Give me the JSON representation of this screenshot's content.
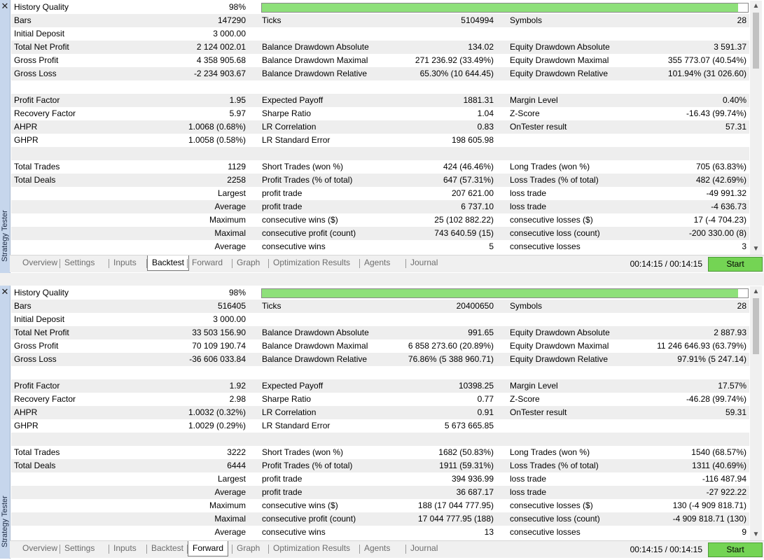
{
  "colors": {
    "progress_fill": "#8ee07a",
    "start_button": "#74d454",
    "sidebar": "#c6d6ec",
    "row_alt": "#eeeeee"
  },
  "panels": [
    {
      "side_label": "Strategy Tester",
      "history_quality_label": "History Quality",
      "history_quality_value": "98%",
      "history_quality_fraction": 0.98,
      "rows": [
        [
          "Bars",
          "147290",
          "Ticks",
          "5104994",
          "Symbols",
          "28"
        ],
        [
          "Initial Deposit",
          "3 000.00",
          "",
          "",
          "",
          ""
        ],
        [
          "Total Net Profit",
          "2 124 002.01",
          "Balance Drawdown Absolute",
          "134.02",
          "Equity Drawdown Absolute",
          "3 591.37"
        ],
        [
          "Gross Profit",
          "4 358 905.68",
          "Balance Drawdown Maximal",
          "271 236.92 (33.49%)",
          "Equity Drawdown Maximal",
          "355 773.07 (40.54%)"
        ],
        [
          "Gross Loss",
          "-2 234 903.67",
          "Balance Drawdown Relative",
          "65.30% (10 644.45)",
          "Equity Drawdown Relative",
          "101.94% (31 026.60)"
        ],
        [
          "",
          "",
          "",
          "",
          "",
          ""
        ],
        [
          "Profit Factor",
          "1.95",
          "Expected Payoff",
          "1881.31",
          "Margin Level",
          "0.40%"
        ],
        [
          "Recovery Factor",
          "5.97",
          "Sharpe Ratio",
          "1.04",
          "Z-Score",
          "-16.43 (99.74%)"
        ],
        [
          "AHPR",
          "1.0068 (0.68%)",
          "LR Correlation",
          "0.83",
          "OnTester result",
          "57.31"
        ],
        [
          "GHPR",
          "1.0058 (0.58%)",
          "LR Standard Error",
          "198 605.98",
          "",
          ""
        ],
        [
          "",
          "",
          "",
          "",
          "",
          ""
        ],
        [
          "Total Trades",
          "1129",
          "Short Trades (won %)",
          "424 (46.46%)",
          "Long Trades (won %)",
          "705 (63.83%)"
        ],
        [
          "Total Deals",
          "2258",
          "Profit Trades (% of total)",
          "647 (57.31%)",
          "Loss Trades (% of total)",
          "482 (42.69%)"
        ],
        [
          "",
          "Largest",
          "profit trade",
          "207 621.00",
          "loss trade",
          "-49 991.32"
        ],
        [
          "",
          "Average",
          "profit trade",
          "6 737.10",
          "loss trade",
          "-4 636.73"
        ],
        [
          "",
          "Maximum",
          "consecutive wins ($)",
          "25 (102 882.22)",
          "consecutive losses ($)",
          "17 (-4 704.23)"
        ],
        [
          "",
          "Maximal",
          "consecutive profit (count)",
          "743 640.59 (15)",
          "consecutive loss (count)",
          "-200 330.00 (8)"
        ],
        [
          "",
          "Average",
          "consecutive wins",
          "5",
          "consecutive losses",
          "3"
        ]
      ],
      "tabs": [
        "Overview",
        "Settings",
        "Inputs",
        "Backtest",
        "Forward",
        "Graph",
        "Optimization Results",
        "Agents",
        "Journal"
      ],
      "active_tab": "Backtest",
      "timer": "00:14:15 / 00:14:15",
      "start_label": "Start"
    },
    {
      "side_label": "Strategy Tester",
      "history_quality_label": "History Quality",
      "history_quality_value": "98%",
      "history_quality_fraction": 0.98,
      "rows": [
        [
          "Bars",
          "516405",
          "Ticks",
          "20400650",
          "Symbols",
          "28"
        ],
        [
          "Initial Deposit",
          "3 000.00",
          "",
          "",
          "",
          ""
        ],
        [
          "Total Net Profit",
          "33 503 156.90",
          "Balance Drawdown Absolute",
          "991.65",
          "Equity Drawdown Absolute",
          "2 887.93"
        ],
        [
          "Gross Profit",
          "70 109 190.74",
          "Balance Drawdown Maximal",
          "6 858 273.60 (20.89%)",
          "Equity Drawdown Maximal",
          "11 246 646.93 (63.79%)"
        ],
        [
          "Gross Loss",
          "-36 606 033.84",
          "Balance Drawdown Relative",
          "76.86% (5 388 960.71)",
          "Equity Drawdown Relative",
          "97.91% (5 247.14)"
        ],
        [
          "",
          "",
          "",
          "",
          "",
          ""
        ],
        [
          "Profit Factor",
          "1.92",
          "Expected Payoff",
          "10398.25",
          "Margin Level",
          "17.57%"
        ],
        [
          "Recovery Factor",
          "2.98",
          "Sharpe Ratio",
          "0.77",
          "Z-Score",
          "-46.28 (99.74%)"
        ],
        [
          "AHPR",
          "1.0032 (0.32%)",
          "LR Correlation",
          "0.91",
          "OnTester result",
          "59.31"
        ],
        [
          "GHPR",
          "1.0029 (0.29%)",
          "LR Standard Error",
          "5 673 665.85",
          "",
          ""
        ],
        [
          "",
          "",
          "",
          "",
          "",
          ""
        ],
        [
          "Total Trades",
          "3222",
          "Short Trades (won %)",
          "1682 (50.83%)",
          "Long Trades (won %)",
          "1540 (68.57%)"
        ],
        [
          "Total Deals",
          "6444",
          "Profit Trades (% of total)",
          "1911 (59.31%)",
          "Loss Trades (% of total)",
          "1311 (40.69%)"
        ],
        [
          "",
          "Largest",
          "profit trade",
          "394 936.99",
          "loss trade",
          "-116 487.94"
        ],
        [
          "",
          "Average",
          "profit trade",
          "36 687.17",
          "loss trade",
          "-27 922.22"
        ],
        [
          "",
          "Maximum",
          "consecutive wins ($)",
          "188 (17 044 777.95)",
          "consecutive losses ($)",
          "130 (-4 909 818.71)"
        ],
        [
          "",
          "Maximal",
          "consecutive profit (count)",
          "17 044 777.95 (188)",
          "consecutive loss (count)",
          "-4 909 818.71 (130)"
        ],
        [
          "",
          "Average",
          "consecutive wins",
          "13",
          "consecutive losses",
          "9"
        ]
      ],
      "tabs": [
        "Overview",
        "Settings",
        "Inputs",
        "Backtest",
        "Forward",
        "Graph",
        "Optimization Results",
        "Agents",
        "Journal"
      ],
      "active_tab": "Forward",
      "timer": "00:14:15 / 00:14:15",
      "start_label": "Start"
    }
  ]
}
